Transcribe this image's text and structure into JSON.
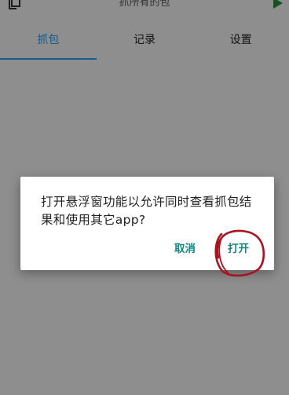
{
  "app": {
    "title": "抓所有的包",
    "tabs": [
      {
        "label": "抓包",
        "active": true
      },
      {
        "label": "记录",
        "active": false
      },
      {
        "label": "设置",
        "active": false
      }
    ],
    "accent_color": "#2a9df4",
    "play_icon": "play-icon",
    "copy_icon": "copy-icon"
  },
  "dialog": {
    "message": "打开悬浮窗功能以允许同时查看抓包结果和使用其它app?",
    "cancel_label": "取消",
    "open_label": "打开",
    "button_color": "#14897f"
  },
  "annotation": {
    "color": "#a8131f"
  }
}
